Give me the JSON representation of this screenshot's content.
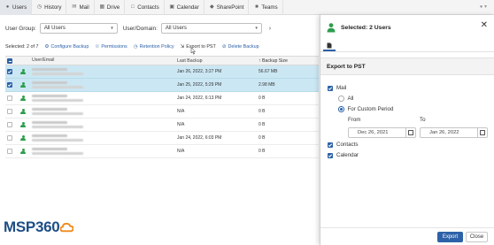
{
  "nav": {
    "tabs": [
      {
        "label": "Users",
        "icon": "users-icon"
      },
      {
        "label": "History",
        "icon": "history-icon"
      },
      {
        "label": "Mail",
        "icon": "mail-icon"
      },
      {
        "label": "Drive",
        "icon": "drive-icon"
      },
      {
        "label": "Contacts",
        "icon": "contacts-icon"
      },
      {
        "label": "Calendar",
        "icon": "calendar-icon"
      },
      {
        "label": "SharePoint",
        "icon": "sharepoint-icon"
      },
      {
        "label": "Teams",
        "icon": "teams-icon"
      }
    ]
  },
  "filters": {
    "user_group_label": "User Group:",
    "user_group_value": "All Users",
    "user_domain_label": "User/Domain:",
    "user_domain_value": "All Users"
  },
  "toolbar": {
    "selected_text": "Selected: 2 of 7",
    "configure_backup": "Configure Backup",
    "permissions": "Permissions",
    "retention_policy": "Retention Policy",
    "export_to_pst": "Export to PST",
    "delete_backup": "Delete Backup"
  },
  "table": {
    "headers": {
      "user": "User/Email",
      "last_backup": "Last Backup",
      "size": "Backup Size",
      "sort_indicator": "↑"
    },
    "rows": [
      {
        "checked": true,
        "last_backup": "Jan 26, 2022, 3:27 PM",
        "size": "56.67 MB"
      },
      {
        "checked": true,
        "last_backup": "Jan 25, 2022, 5:29 PM",
        "size": "2.98 MB"
      },
      {
        "checked": false,
        "last_backup": "Jan 24, 2022, 6:13 PM",
        "size": "0 B"
      },
      {
        "checked": false,
        "last_backup": "N/A",
        "size": "0 B"
      },
      {
        "checked": false,
        "last_backup": "N/A",
        "size": "0 B"
      },
      {
        "checked": false,
        "last_backup": "Jan 24, 2022, 6:03 PM",
        "size": "0 B"
      },
      {
        "checked": false,
        "last_backup": "N/A",
        "size": "0 B"
      }
    ]
  },
  "logo": {
    "text_a": "MSP",
    "text_b": "360"
  },
  "panel": {
    "title": "Selected: 2 Users",
    "section_title": "Export to PST",
    "mail_label": "Mail",
    "all_label": "All",
    "custom_label": "For Custom Period",
    "from_label": "From",
    "to_label": "To",
    "from_date": "Dec 26, 2021",
    "to_date": "Jan 26, 2022",
    "contacts_label": "Contacts",
    "calendar_label": "Calendar",
    "export_button": "Export",
    "close_button": "Close"
  },
  "colors": {
    "accent": "#2d62a8",
    "selected_row": "#cce7f4",
    "user_icon": "#2e9d4d",
    "logo_blue": "#1e4e86",
    "logo_orange": "#f08a1c"
  }
}
